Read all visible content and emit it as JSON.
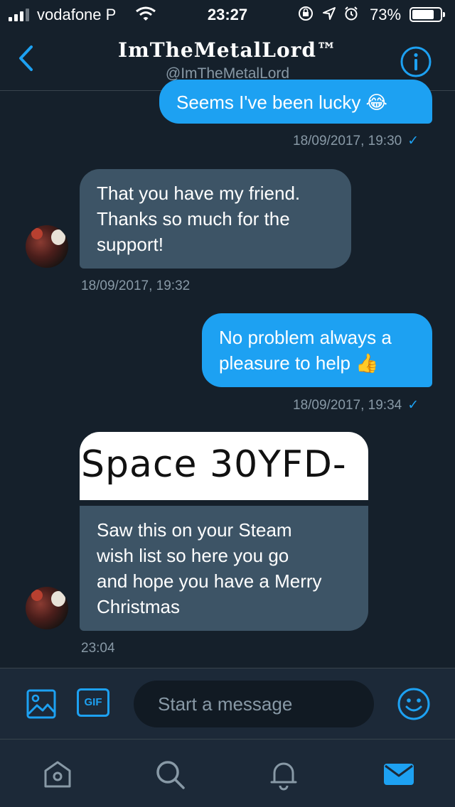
{
  "status_bar": {
    "carrier": "vodafone P",
    "time": "23:27",
    "battery": "73%"
  },
  "header": {
    "title": "ImTheMetalLord™",
    "handle": "@ImTheMetalLord"
  },
  "messages": [
    {
      "direction": "out",
      "text": "Seems I've been lucky 😂",
      "timestamp": "18/09/2017, 19:30",
      "check": "✓"
    },
    {
      "direction": "in",
      "lines": [
        "That you have my friend.",
        "Thanks so much for the",
        "support!"
      ],
      "timestamp": "18/09/2017, 19:32"
    },
    {
      "direction": "out",
      "lines": [
        "No problem always a",
        "pleasure to help 👍"
      ],
      "timestamp": "18/09/2017, 19:34",
      "check": "✓"
    },
    {
      "direction": "in",
      "image_text": "Space 30YFD-",
      "lines": [
        "Saw this on your Steam",
        "wish list so here you go",
        "and hope you have a Merry",
        "Christmas"
      ],
      "timestamp": "23:04"
    }
  ],
  "composer": {
    "gif_label": "GIF",
    "placeholder": "Start a message"
  },
  "colors": {
    "background": "#15202b",
    "accent": "#1da1f2",
    "incoming_bubble": "#3d5466",
    "secondary_text": "#8899a6"
  },
  "icons": {
    "header": [
      "back-chevron-icon",
      "info-icon"
    ],
    "composer": [
      "image-icon",
      "gif-icon",
      "emoji-icon"
    ],
    "tabs": [
      "home-icon",
      "search-icon",
      "notifications-icon",
      "messages-icon"
    ]
  }
}
